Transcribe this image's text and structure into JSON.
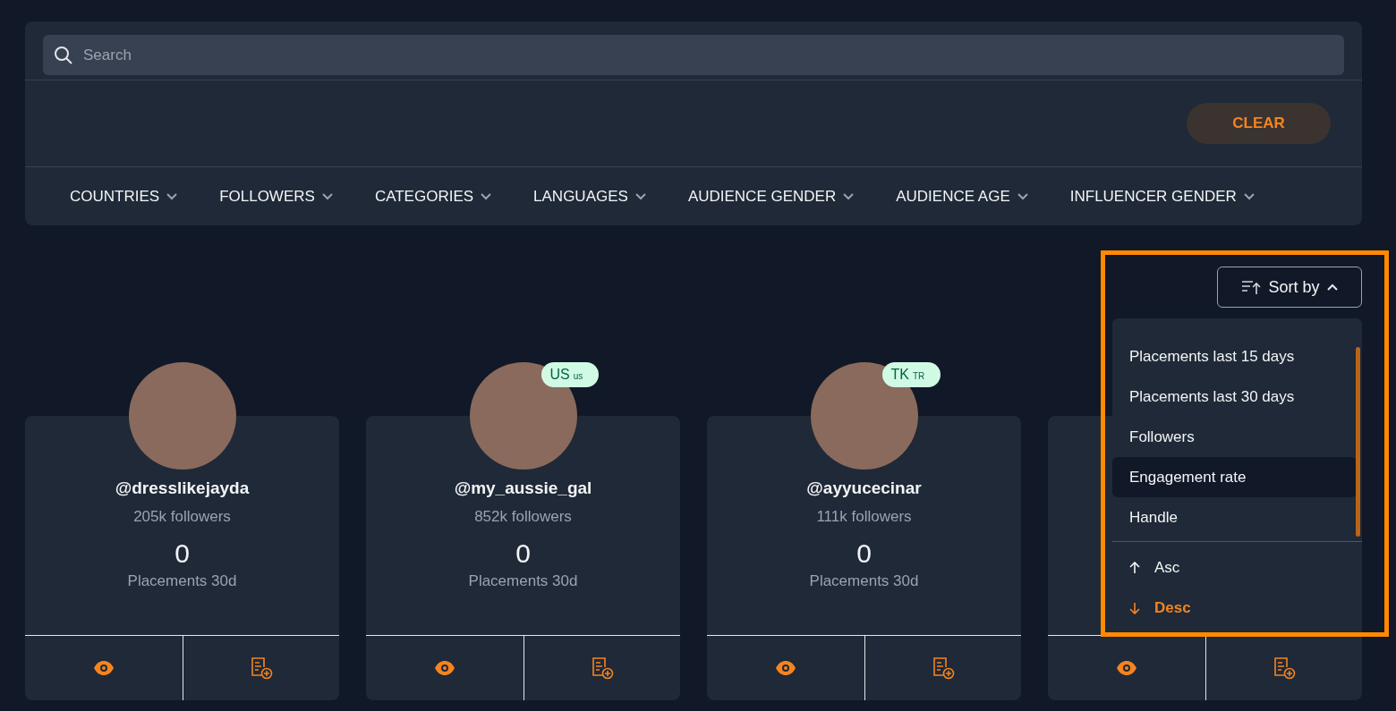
{
  "search": {
    "placeholder": "Search"
  },
  "clear_button": "CLEAR",
  "filters": [
    "COUNTRIES",
    "FOLLOWERS",
    "CATEGORIES",
    "LANGUAGES",
    "AUDIENCE GENDER",
    "AUDIENCE AGE",
    "INFLUENCER GENDER"
  ],
  "sort": {
    "label": "Sort by",
    "expanded": true,
    "fields": [
      {
        "label": "Placements last 15 days",
        "hovered": false
      },
      {
        "label": "Placements last 30 days",
        "hovered": false
      },
      {
        "label": "Followers",
        "hovered": false
      },
      {
        "label": "Engagement rate",
        "hovered": true
      },
      {
        "label": "Handle",
        "hovered": false
      }
    ],
    "orders": [
      {
        "kind": "asc",
        "label": "Asc",
        "selected": false
      },
      {
        "kind": "desc",
        "label": "Desc",
        "selected": true
      }
    ]
  },
  "cards": [
    {
      "kind": "full",
      "handle": "@dresslikejayda",
      "followers": "205k followers",
      "placements": "0",
      "placements_label": "Placements 30d"
    },
    {
      "kind": "full",
      "handle": "@my_aussie_gal",
      "followers": "852k followers",
      "placements": "0",
      "placements_label": "Placements 30d",
      "badge": {
        "code": "US",
        "sub": "us"
      }
    },
    {
      "kind": "full",
      "handle": "@ayyucecinar",
      "followers": "111k followers",
      "placements": "0",
      "placements_label": "Placements 30d",
      "badge": {
        "code": "TK",
        "sub": "TR"
      }
    },
    {
      "kind": "covered"
    }
  ]
}
